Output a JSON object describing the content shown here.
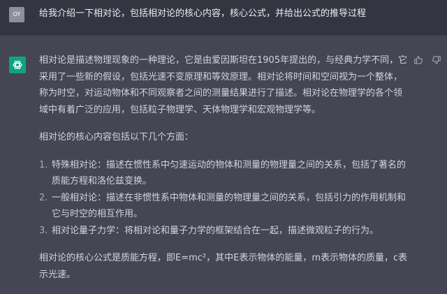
{
  "user": {
    "avatar": "OY",
    "prompt": "给我介绍一下相对论，包括相对论的核心内容，核心公式，并给出公式的推导过程"
  },
  "assistant": {
    "logo_icon": "openai-logo-icon",
    "paragraph1": "相对论是描述物理现象的一种理论，它是由爱因斯坦在1905年提出的，与经典力学不同，它采用了一些新的假设，包括光速不变原理和等效原理。相对论将时间和空间视为一个整体，称为时空，对运动物体和不同观察者之间的测量结果进行了描述。相对论在物理学的各个领域中有着广泛的应用，包括粒子物理学、天体物理学和宏观物理学等。",
    "paragraph2": "相对论的核心内容包括以下几个方面：",
    "list": [
      {
        "num": "1.",
        "text": "特殊相对论：描述在惯性系中匀速运动的物体和测量的物理量之间的关系，包括了著名的质能方程和洛伦兹变换。"
      },
      {
        "num": "2.",
        "text": "一般相对论：描述在非惯性系中物体和测量的物理量之间的关系，包括引力的作用机制和它与时空的相互作用。"
      },
      {
        "num": "3.",
        "text": "相对论量子力学：将相对论和量子力学的框架结合在一起，描述微观粒子的行为。"
      }
    ],
    "paragraph3": "相对论的核心公式是质能方程，即E=mc²，其中E表示物体的能量，m表示物体的质量，c表示光速。"
  },
  "actions": {
    "thumbs_up_icon": "thumbs-up-icon",
    "thumbs_down_icon": "thumbs-down-icon"
  },
  "colors": {
    "user_bg": "#343541",
    "assistant_bg": "#444654",
    "brand": "#10a37f"
  }
}
